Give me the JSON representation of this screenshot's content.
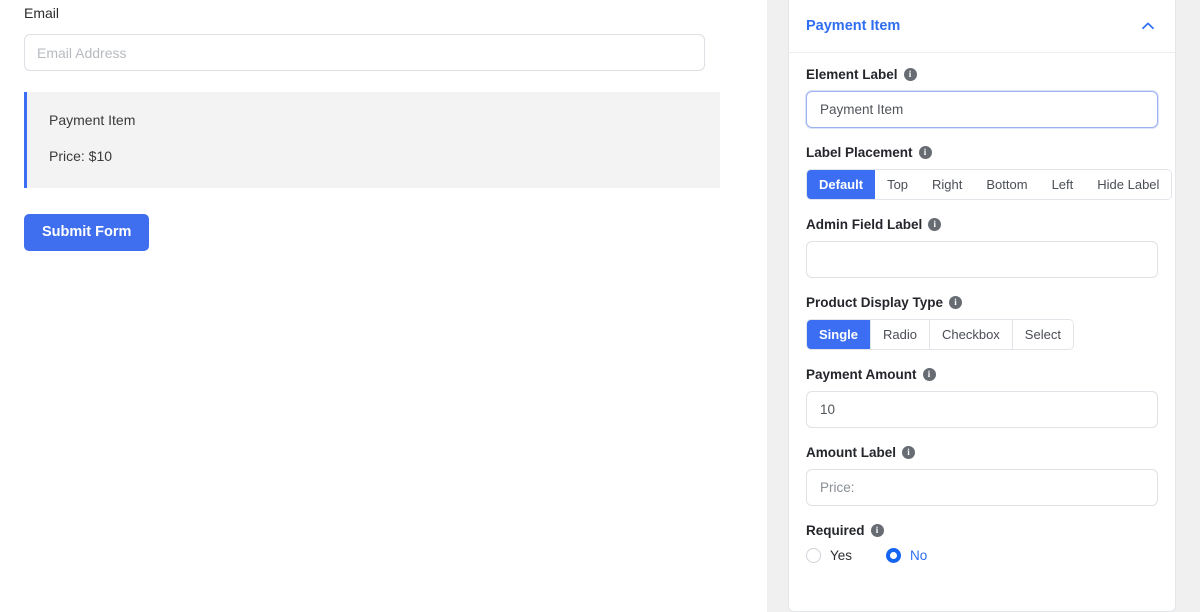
{
  "form_preview": {
    "email_field": {
      "label": "Email",
      "placeholder": "Email Address",
      "value": ""
    },
    "payment_item": {
      "title": "Payment Item",
      "price": "Price: $10",
      "accent_color": "#3b6ef2"
    },
    "submit_button": {
      "label": "Submit Form",
      "color": "#3f6fee"
    }
  },
  "settings_panel": {
    "header": {
      "title": "Payment Item",
      "title_color": "#2f6ef0",
      "collapse_icon": "chevron-up-icon"
    },
    "element_label": {
      "label": "Element Label",
      "info_icon": "info-icon",
      "value": "Payment Item",
      "placeholder": "",
      "focused": true
    },
    "label_placement": {
      "label": "Label Placement",
      "info_icon": "info-icon",
      "options": [
        "Default",
        "Top",
        "Right",
        "Bottom",
        "Left",
        "Hide Label"
      ],
      "selected": "Default",
      "selected_color": "#3b6ef2"
    },
    "admin_field_label": {
      "label": "Admin Field Label",
      "info_icon": "info-icon",
      "value": "",
      "placeholder": ""
    },
    "product_display_type": {
      "label": "Product Display Type",
      "info_icon": "info-icon",
      "options": [
        "Single",
        "Radio",
        "Checkbox",
        "Select"
      ],
      "selected": "Single",
      "selected_color": "#3b6ef2"
    },
    "payment_amount": {
      "label": "Payment Amount",
      "info_icon": "info-icon",
      "value": "10",
      "placeholder": ""
    },
    "amount_label": {
      "label": "Amount Label",
      "info_icon": "info-icon",
      "value": "",
      "placeholder": "Price:"
    },
    "required": {
      "label": "Required",
      "info_icon": "info-icon",
      "options": [
        "Yes",
        "No"
      ],
      "selected": "No",
      "selected_color": "#2f6ef0"
    }
  }
}
